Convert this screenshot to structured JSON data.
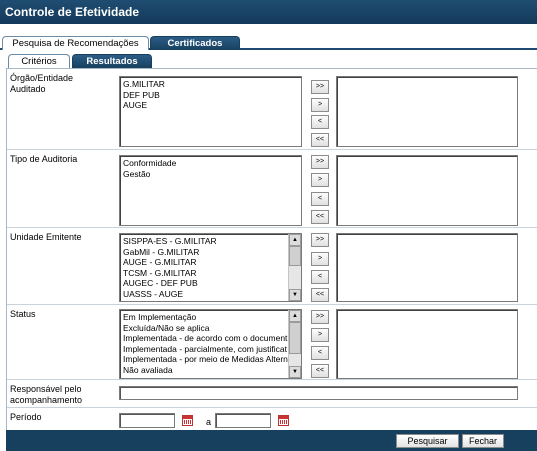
{
  "title": "Controle de Efetividade",
  "main_tabs": [
    "Pesquisa de Recomendações",
    "Certificados"
  ],
  "sub_tabs": [
    "Critérios",
    "Resultados"
  ],
  "fields": {
    "orgao": {
      "label": "Órgão/Entidade Auditado",
      "options": [
        "G.MILITAR",
        "DEF PUB",
        "AUGE"
      ]
    },
    "tipo": {
      "label": "Tipo de Auditoria",
      "options": [
        "Conformidade",
        "Gestão"
      ]
    },
    "unidade": {
      "label": "Unidade Emitente",
      "options": [
        "SISPPA-ES - G.MILITAR",
        "GabMil - G.MILITAR",
        "AUGE - G.MILITAR",
        "TCSM - G.MILITAR",
        "AUGEC - DEF PUB",
        "UASSS - AUGE"
      ]
    },
    "status": {
      "label": "Status",
      "options": [
        "Em Implementação",
        "Excluída/Não se aplica",
        "Implementada - de acordo com o document",
        "Implementada - parcialmente, com justificat",
        "Implementada - por meio de Medidas Altern",
        "Não avaliada"
      ]
    },
    "responsavel": {
      "label": "Responsável pelo acompanhamento",
      "value": ""
    },
    "periodo": {
      "label": "Período",
      "separator": "a",
      "from": "",
      "to": ""
    }
  },
  "move_buttons": {
    "add_all": ">>",
    "add": ">",
    "remove": "<",
    "remove_all": "<<"
  },
  "scroll_arrows": {
    "up": "▲",
    "down": "▼"
  },
  "footer": {
    "search": "Pesquisar",
    "close": "Fechar"
  },
  "colors": {
    "header_bg": "#17405f",
    "tab_bg": "#2c5c86"
  },
  "icons": {
    "calendar": "calendar-icon"
  }
}
